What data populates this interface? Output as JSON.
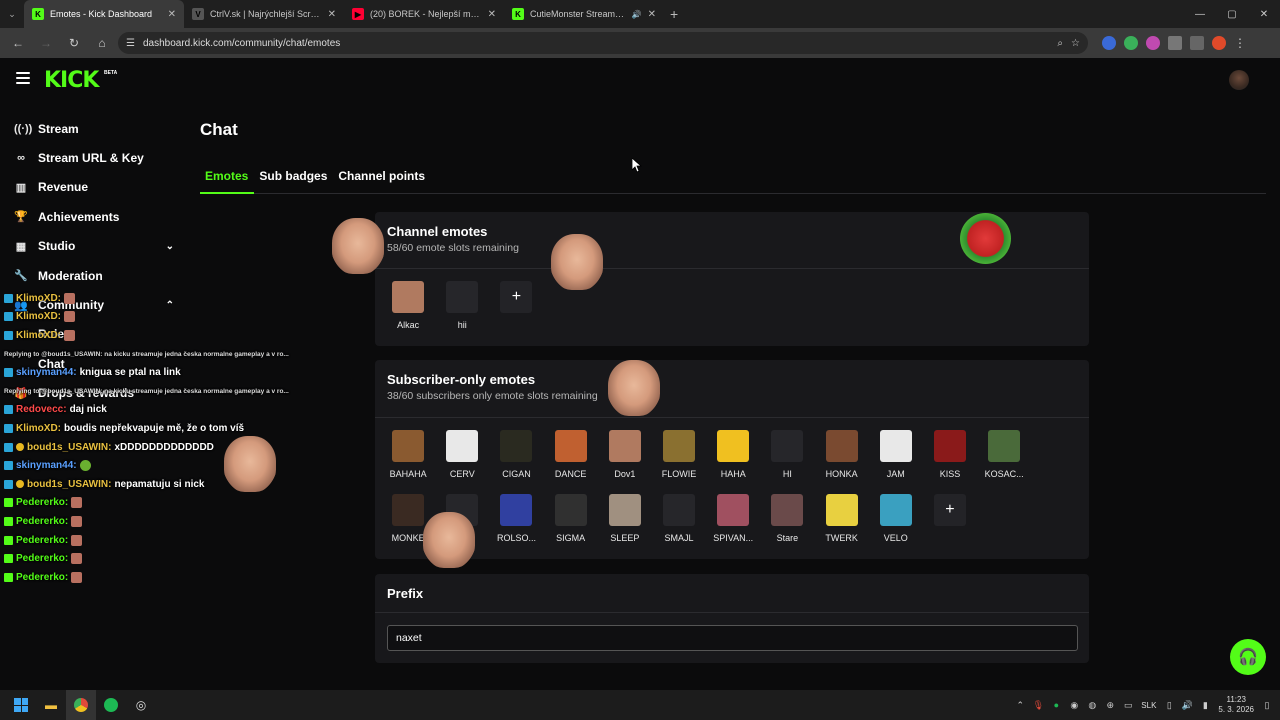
{
  "browser": {
    "tabs": [
      {
        "title": "Emotes - Kick Dashboard",
        "active": true,
        "favicon": "kick-favicon",
        "fav_color": "#53fc18",
        "fav_letter": "K"
      },
      {
        "title": "CtrlV.sk | Najrýchlejší ScreenSh",
        "active": false,
        "favicon": "ctrlv-favicon",
        "fav_color": "#555555",
        "fav_letter": "V"
      },
      {
        "title": "(20) BOREK - Nejlepší mořský p",
        "active": false,
        "favicon": "youtube-favicon",
        "fav_color": "#ff0033",
        "fav_letter": "▶"
      },
      {
        "title": "CutieMonster Stream - Wat",
        "active": false,
        "favicon": "kick-favicon",
        "fav_color": "#53fc18",
        "fav_letter": "K",
        "audio": true
      }
    ],
    "url": "dashboard.kick.com/community/chat/emotes"
  },
  "header": {
    "logo": "KICK",
    "beta": "BETA"
  },
  "sidebar": {
    "items": [
      {
        "label": "Stream",
        "icon": "broadcast-icon",
        "glyph": "((·))"
      },
      {
        "label": "Stream URL & Key",
        "icon": "link-icon",
        "glyph": "∞"
      },
      {
        "label": "Revenue",
        "icon": "chart-icon",
        "glyph": "▥"
      },
      {
        "label": "Achievements",
        "icon": "trophy-icon",
        "glyph": "🏆"
      },
      {
        "label": "Studio",
        "icon": "studio-icon",
        "glyph": "▦",
        "chevron": "⌄"
      },
      {
        "label": "Moderation",
        "icon": "wrench-icon",
        "glyph": "🔧"
      },
      {
        "label": "Community",
        "icon": "community-icon",
        "glyph": "👥",
        "chevron": "⌃"
      }
    ],
    "sub_items": [
      {
        "label": "Roles"
      },
      {
        "label": "Chat"
      }
    ],
    "last_item": {
      "label": "Drops & rewards",
      "icon": "gift-icon",
      "glyph": "🎁"
    }
  },
  "overlay": {
    "lines": [
      {
        "user": "KlimoXD:",
        "color": "#e8c040",
        "text": "",
        "badge": "blue",
        "emoji": "face"
      },
      {
        "user": "KlimoXD:",
        "color": "#e8c040",
        "text": "",
        "badge": "blue",
        "emoji": "face"
      },
      {
        "user": "KlimoXD:",
        "color": "#e8c040",
        "text": "",
        "badge": "blue",
        "emoji": "face"
      },
      {
        "reply": "Replying to @boud1s_USAWIN: na kicku streamuje jedna česka normalne gameplay a v ro..."
      },
      {
        "user": "skinyman44:",
        "color": "#5aa0ff",
        "text": "knigua se ptal na link",
        "badge": "blue"
      },
      {
        "reply": "Replying to @boud1s_USAWIN: na kicku streamuje jedna česka normalne gameplay a v ro..."
      },
      {
        "user": "Redovecc:",
        "color": "#ff4a4a",
        "text": "daj nick",
        "badge": "blue"
      },
      {
        "user": "KlimoXD:",
        "color": "#e8c040",
        "text": "boudis nepřekvapuje mě, že o tom víš",
        "badge": "blue"
      },
      {
        "user": "boud1s_USAWIN:",
        "color": "#e8c040",
        "text": "xDDDDDDDDDDDDD",
        "badge": "blue",
        "coin": true
      },
      {
        "user": "skinyman44:",
        "color": "#5aa0ff",
        "text": "",
        "badge": "blue",
        "emoji": "cabbage"
      },
      {
        "user": "boud1s_USAWIN:",
        "color": "#e8c040",
        "text": "nepamatuju si nick",
        "badge": "blue",
        "coin": true
      },
      {
        "user": "Pedererko:",
        "color": "#53fc18",
        "text": "",
        "badge": "green",
        "emoji": "face"
      },
      {
        "user": "Pedererko:",
        "color": "#53fc18",
        "text": "",
        "badge": "green",
        "emoji": "face"
      },
      {
        "user": "Pedererko:",
        "color": "#53fc18",
        "text": "",
        "badge": "green",
        "emoji": "face"
      },
      {
        "user": "Pedererko:",
        "color": "#53fc18",
        "text": "",
        "badge": "green",
        "emoji": "face"
      },
      {
        "user": "Pedererko:",
        "color": "#53fc18",
        "text": "",
        "badge": "green",
        "emoji": "face"
      }
    ]
  },
  "main": {
    "title": "Chat",
    "tabs": [
      {
        "label": "Emotes",
        "active": true
      },
      {
        "label": "Sub badges",
        "active": false
      },
      {
        "label": "Channel points",
        "active": false
      }
    ],
    "channel_emotes": {
      "title": "Channel emotes",
      "subtitle": "58/60 emote slots remaining",
      "emotes": [
        {
          "name": "Alkac",
          "color": "#b07a60"
        },
        {
          "name": "hii",
          "color": "#26262a"
        }
      ],
      "add_label": "+"
    },
    "subscriber_emotes": {
      "title": "Subscriber-only emotes",
      "subtitle": "38/60 subscribers only emote slots remaining",
      "emotes": [
        {
          "name": "BAHAHA",
          "color": "#8a5a30"
        },
        {
          "name": "CERV",
          "color": "#e8e8e8"
        },
        {
          "name": "CIGAN",
          "color": "#2a2a20"
        },
        {
          "name": "DANCE",
          "color": "#c06030"
        },
        {
          "name": "Dov1",
          "color": "#b07a60"
        },
        {
          "name": "FLOWIE",
          "color": "#8a7030"
        },
        {
          "name": "HAHA",
          "color": "#f0c020"
        },
        {
          "name": "HI",
          "color": "#26262a"
        },
        {
          "name": "HONKA",
          "color": "#7a4a30"
        },
        {
          "name": "JAM",
          "color": "#e8e8e8"
        },
        {
          "name": "KISS",
          "color": "#8a1a1a"
        },
        {
          "name": "KOSAC...",
          "color": "#4a6a3a"
        },
        {
          "name": "MONKE",
          "color": "#3a2a22"
        },
        {
          "name": "...",
          "color": "#26262a"
        },
        {
          "name": "ROLSO...",
          "color": "#3040a0"
        },
        {
          "name": "SIGMA",
          "color": "#303030"
        },
        {
          "name": "SLEEP",
          "color": "#a09080"
        },
        {
          "name": "SMAJL",
          "color": "#26262a"
        },
        {
          "name": "SPIVAN...",
          "color": "#a05060"
        },
        {
          "name": "Stare",
          "color": "#6a4a4a"
        },
        {
          "name": "TWERK",
          "color": "#e8d040"
        },
        {
          "name": "VELO",
          "color": "#3aa0c0"
        }
      ],
      "add_label": "+"
    },
    "prefix": {
      "title": "Prefix",
      "value": "naxet"
    }
  },
  "taskbar": {
    "lang": "SLK",
    "time": "11:23",
    "date": "5. 3. 2026"
  },
  "colors": {
    "accent": "#53fc18",
    "card_bg": "#18181b",
    "page_bg": "#0b0b0c"
  }
}
